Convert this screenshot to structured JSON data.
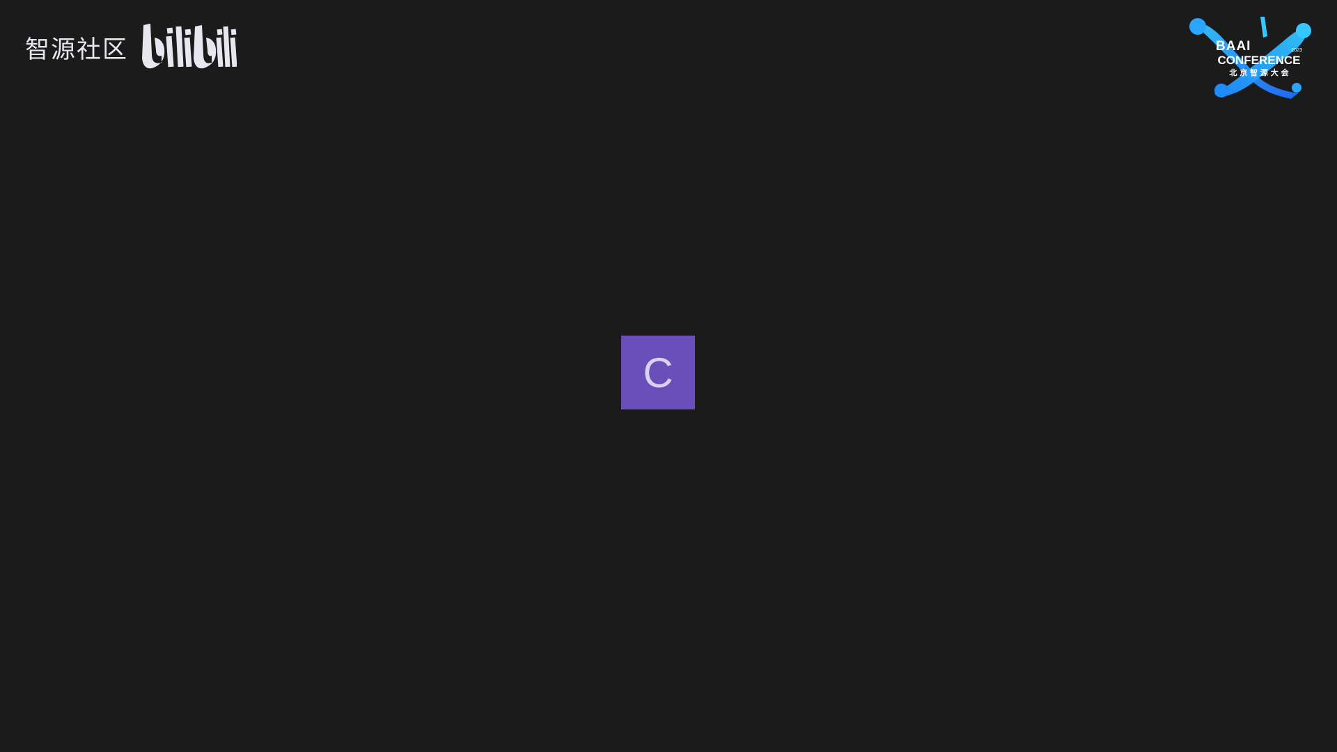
{
  "watermark": {
    "community_label": "智源社区",
    "platform_logo": "bilibili-logo",
    "colors": {
      "text": "#e9e6ef"
    }
  },
  "conference_logo": {
    "title_line1": "BAAI",
    "title_line2": "CONFERENCE",
    "subtitle": "北 京 智 源 大 会",
    "year": "2023",
    "colors": {
      "accent_blue": "#1e8bff",
      "accent_cyan": "#35c7ff"
    }
  },
  "participant": {
    "initial": "C",
    "tile_color": "#6a4fba"
  },
  "background_color": "#1b1b1b"
}
